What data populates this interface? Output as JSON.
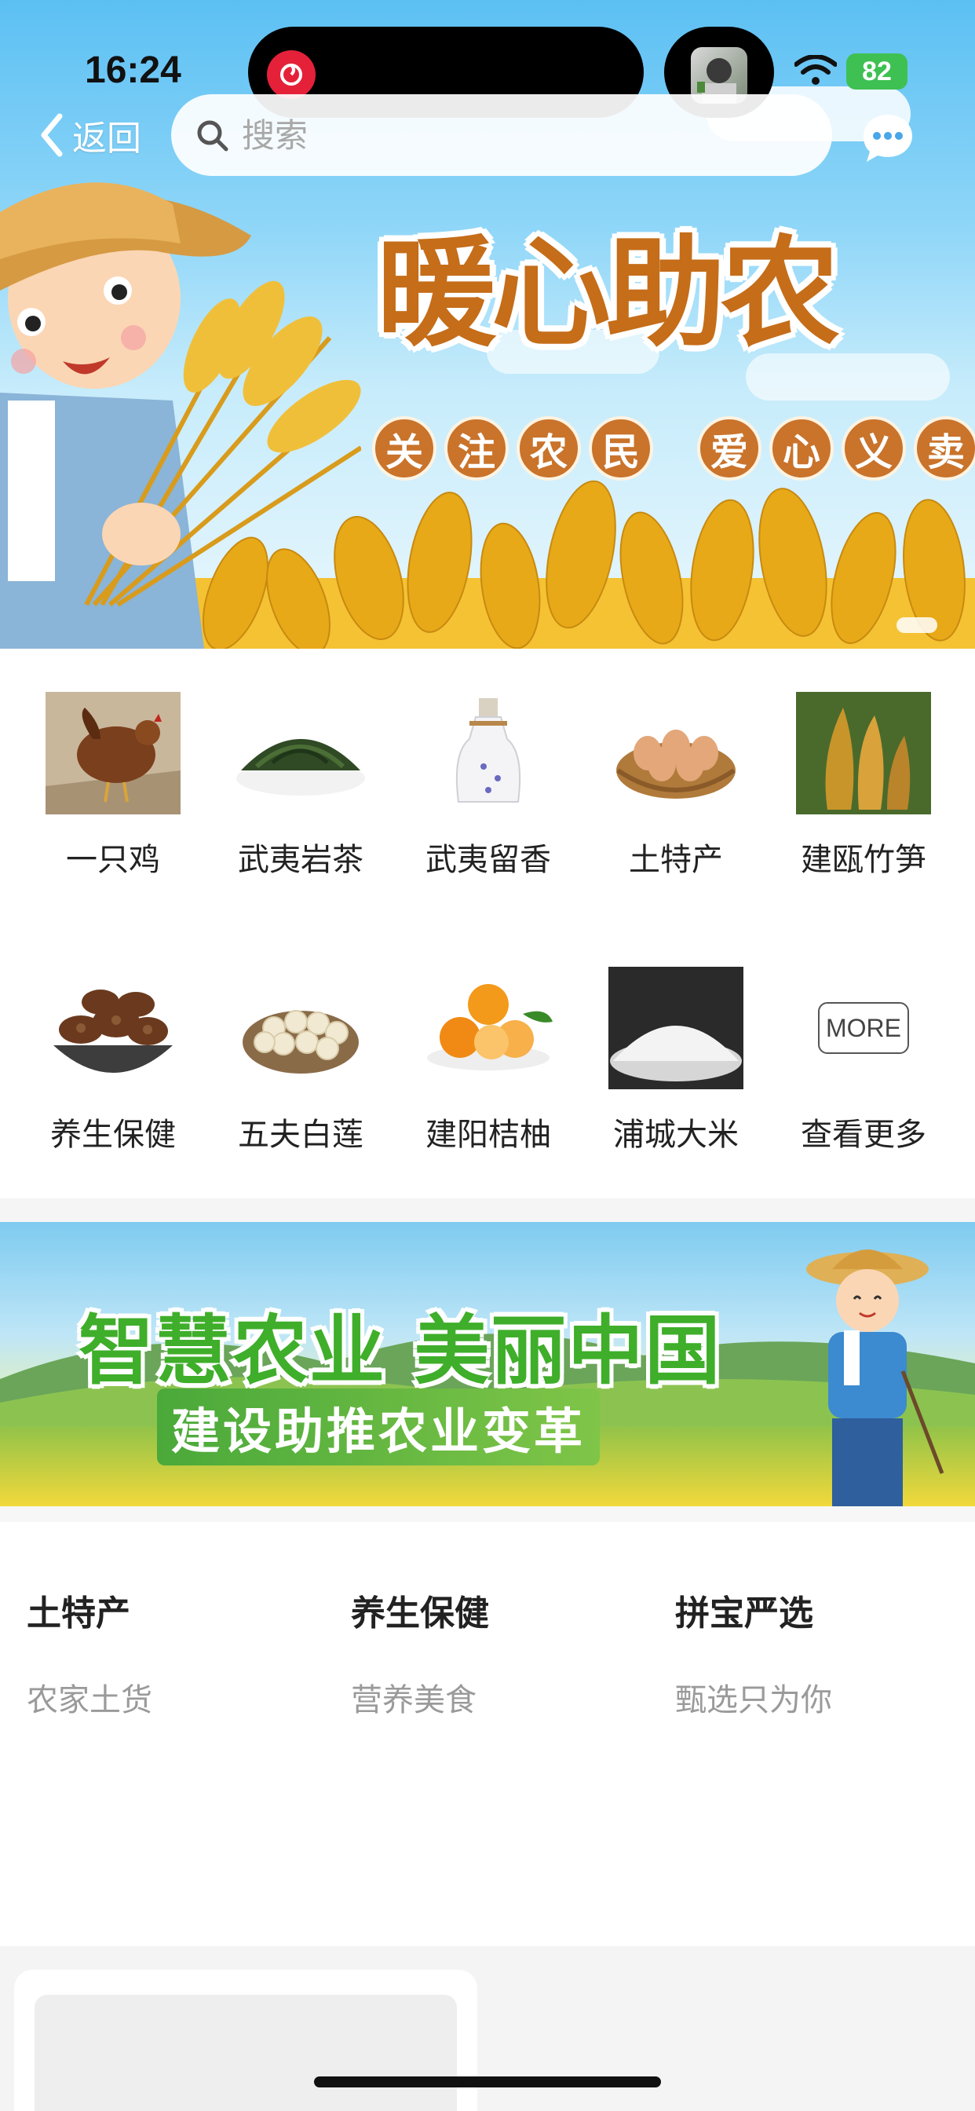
{
  "status_bar": {
    "time": "16:24",
    "battery": "82"
  },
  "nav": {
    "back_label": "返回",
    "search_placeholder": "搜索"
  },
  "hero": {
    "title": "暖心助农",
    "slogan_left": [
      "关",
      "注",
      "农",
      "民"
    ],
    "slogan_right": [
      "爱",
      "心",
      "义",
      "卖"
    ]
  },
  "categories": [
    {
      "label": "一只鸡",
      "icon": "chicken-image"
    },
    {
      "label": "武夷岩茶",
      "icon": "tea-leaves-image"
    },
    {
      "label": "武夷留香",
      "icon": "liquor-bottle-image"
    },
    {
      "label": "土特产",
      "icon": "egg-basket-image"
    },
    {
      "label": "建瓯竹笋",
      "icon": "bamboo-shoot-image"
    },
    {
      "label": "养生保健",
      "icon": "mushroom-bowl-image"
    },
    {
      "label": "五夫白莲",
      "icon": "lotus-seed-image"
    },
    {
      "label": "建阳桔柚",
      "icon": "orange-image"
    },
    {
      "label": "浦城大米",
      "icon": "rice-image"
    },
    {
      "label": "查看更多",
      "icon": "more-box"
    }
  ],
  "more_badge": "MORE",
  "banner2": {
    "title": "智慧农业 美丽中国",
    "subtitle": "建设助推农业变革"
  },
  "features": [
    {
      "title": "土特产",
      "subtitle": "农家土货"
    },
    {
      "title": "养生保健",
      "subtitle": "营养美食"
    },
    {
      "title": "拼宝严选",
      "subtitle": "甄选只为你"
    }
  ],
  "colors": {
    "accent_orange": "#c56d19",
    "accent_green": "#3fae2a",
    "battery_green": "#3ec152"
  }
}
